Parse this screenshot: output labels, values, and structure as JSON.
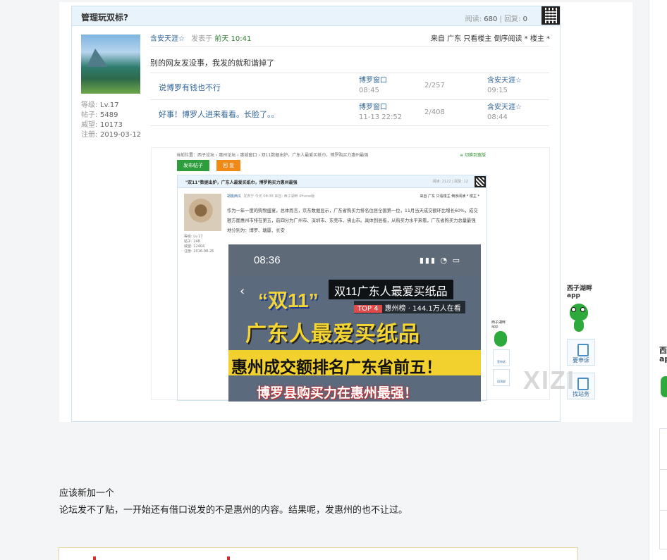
{
  "post": {
    "title": "管理玩双标?",
    "stats_read_label": "阅读:",
    "stats_read": "680",
    "stats_sep": "|",
    "stats_reply_label": "回复:",
    "stats_reply": "0",
    "author": "含安天涯☆",
    "posted_prefix": "发表于",
    "posted_time": "前天 10:41",
    "meta_right": "来自 广东 只看楼主 倒序阅读 * 楼主 *",
    "text": "别的网友发没事，我发的就和谐掉了",
    "user_meta": [
      {
        "k": "等级:",
        "v": "Lv.17"
      },
      {
        "k": "帖子:",
        "v": "5489"
      },
      {
        "k": "威望:",
        "v": "10173"
      },
      {
        "k": "注册:",
        "v": "2019-03-12"
      }
    ],
    "threads": [
      {
        "title": "说博罗有钱也不行",
        "forum": "博罗窗口",
        "forum_time": "08:45",
        "count": "2/257",
        "last_user": "含安天涯☆",
        "last_time": "09:15"
      },
      {
        "title": "好事！博罗人进来看看。长脸了。。",
        "forum": "博罗窗口",
        "forum_time": "11-13 22:52",
        "count": "2/408",
        "last_user": "含安天涯☆",
        "last_time": "08:44"
      }
    ]
  },
  "embed": {
    "crumb": "当前位置：西子论坛 › 惠州论坛 › 惠城窗口 › 双11数据出炉，广东人最爱买纸巾，博罗购买力惠州最强",
    "ctrl": "≡ 切换到宽版",
    "btn_post": "发布帖子",
    "btn_reply": "回 复",
    "title": "\"双11\"数据出炉，广东人最爱买纸巾，博罗购买力惠州最强",
    "stats": "阅读: 2122 | 回复: 12",
    "author": "胡桃西瓜",
    "posted": "发表于 今天 08:38 来自: 西子湖畔 iPhone版",
    "meta_right": "来自 广东 只看楼主 倒序阅读 * 楼主 *",
    "user_meta": [
      "等级: Lv.17",
      "帖子: 248",
      "威望: 12404",
      "注册: 2016-08-26"
    ],
    "body": "作为一年一度的购物盛宴，总体而言，京东数据显示，广东省购买力排名位居全国第一位，11月当天成交额环比增长60%，成交额方面惠州市排在第五，前四分为广州市、深圳市、东莞市、佛山市。具体到县级，从购买力水平来看，广东省购买力总量最强地分别为：博罗、塘厦、长安",
    "side_logo": "西子湖畔 app",
    "side_btn1": "签申诉",
    "side_btn2": "回顶部"
  },
  "phone": {
    "time": "08:36",
    "status": "▮▮▮ ◔ ▭",
    "back": "‹",
    "quote": "“双11”",
    "live_title": "双11广东人最爱买纸品",
    "rank_tag": "TOP 4",
    "rank_text": "惠州榜 · 144.1万人在看",
    "headline": "广东人最爱买纸品",
    "band": "惠州成交额排名广东省前五！",
    "bottom": "博罗县购买力在惠州最强！"
  },
  "float_bar": {
    "logo": "西子湖畔 app",
    "btn1": "要申诉",
    "btn2": "找站务"
  },
  "watermark": "XIZI",
  "rail": {
    "logo": "西 ap"
  },
  "reply": {
    "line1": "应该新加一个",
    "line2": "论坛发不了贴，一开始还有借口说发的不是惠州的内容。结果呢，发惠州的也不让过。"
  },
  "colors": {
    "accent": "#336699",
    "title_bar": "#e8f3fb",
    "frog": "#2ea93b",
    "band": "#f2d02d"
  }
}
